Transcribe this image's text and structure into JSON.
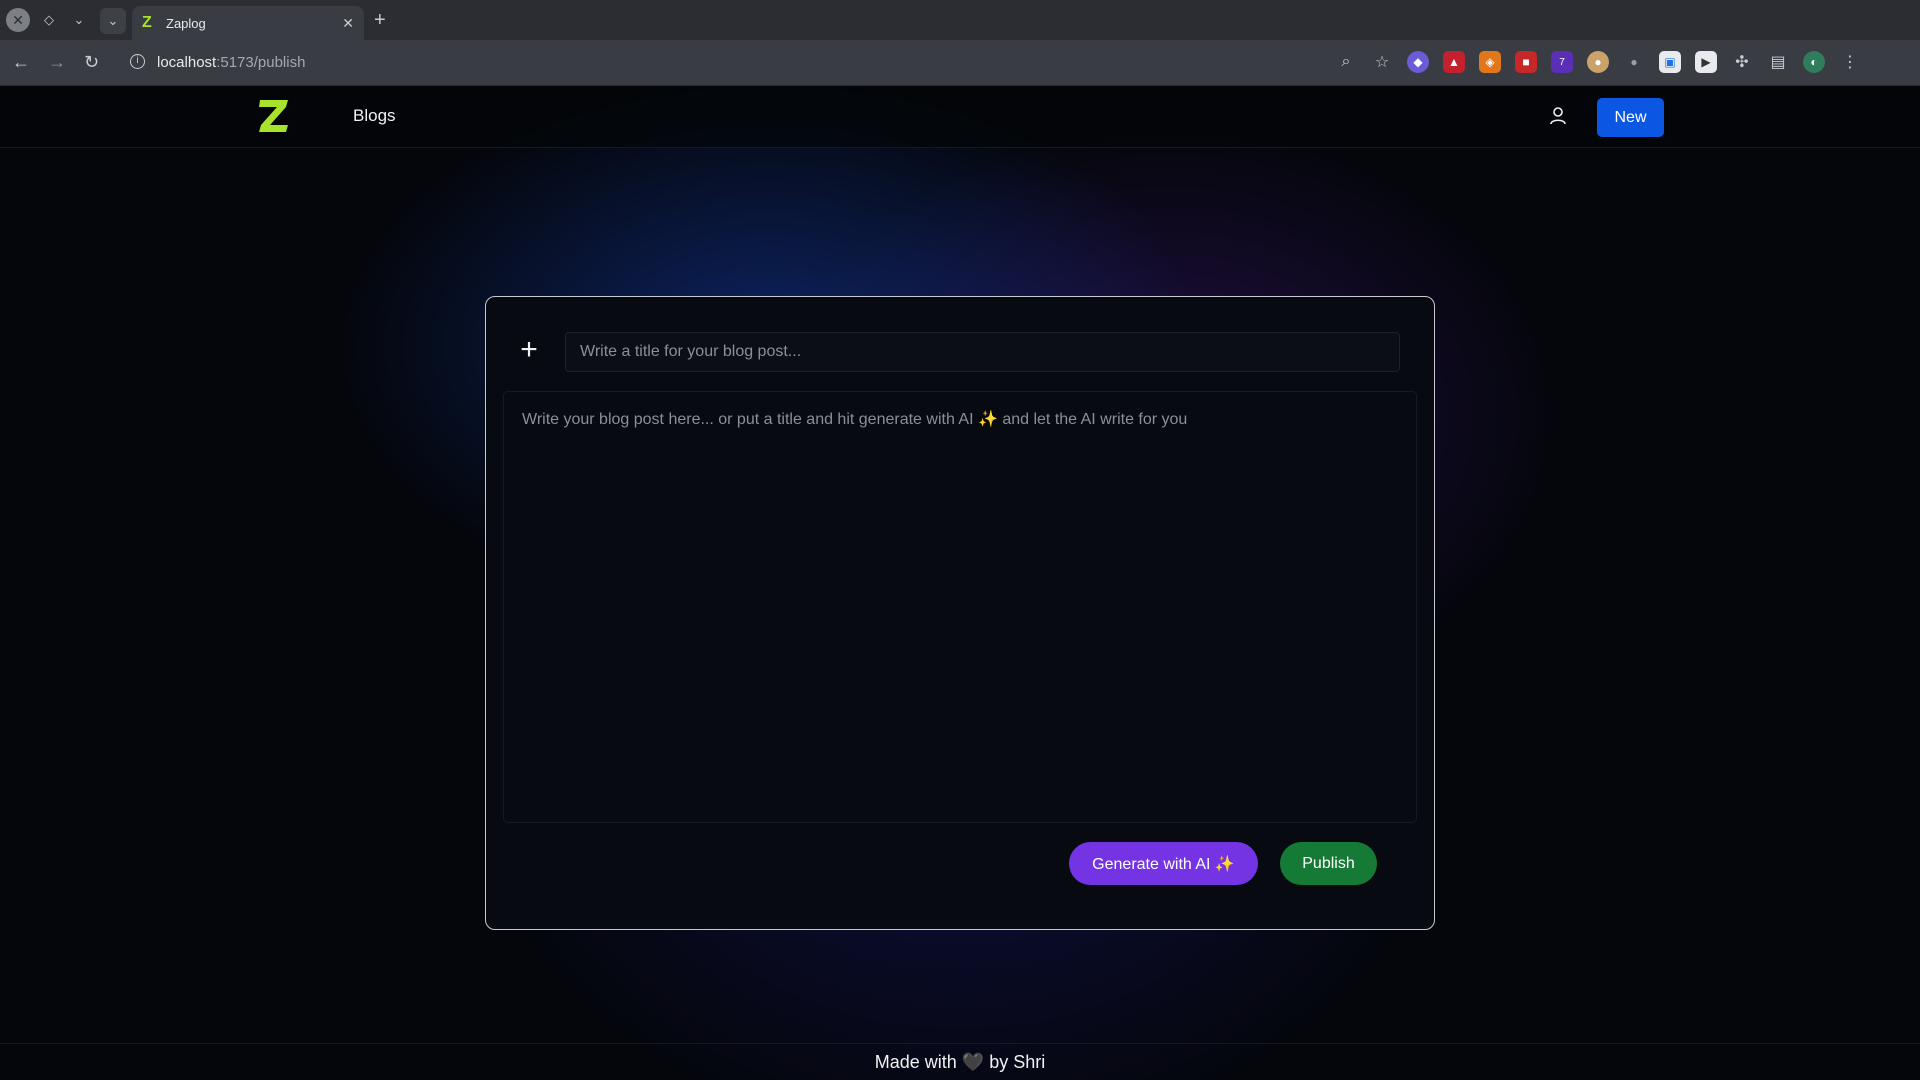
{
  "browser": {
    "tab_title": "Zaplog",
    "url_host": "localhost",
    "url_path": ":5173/publish",
    "extension_badge": "7"
  },
  "header": {
    "nav_blogs": "Blogs",
    "new_button": "New"
  },
  "editor": {
    "title_placeholder": "Write a title for your blog post...",
    "body_placeholder": "Write your blog post here... or put a title and hit generate with AI ✨ and let the AI write for you",
    "generate_button": "Generate with AI ✨",
    "publish_button": "Publish"
  },
  "footer": {
    "text_before": "Made with",
    "heart": "🖤",
    "text_after": "by Shri"
  },
  "colors": {
    "brand_green": "#a8e22a",
    "primary_blue": "#0b56e3",
    "ai_purple": "#7434e3",
    "publish_green": "#157a35"
  }
}
